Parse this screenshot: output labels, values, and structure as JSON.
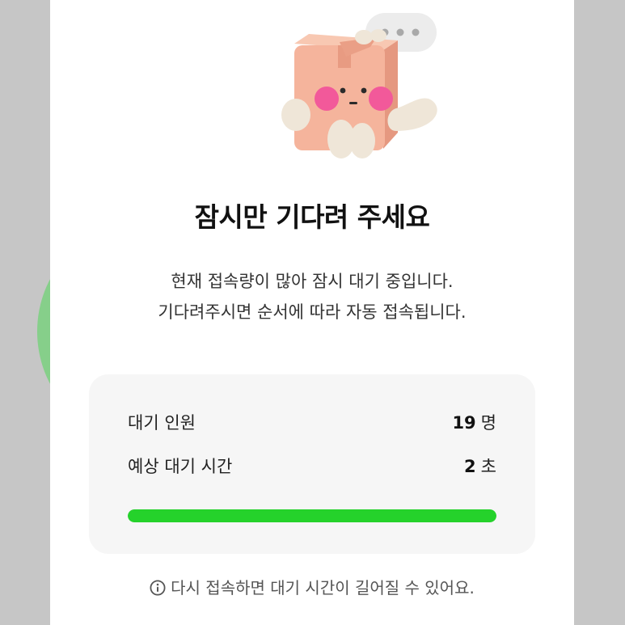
{
  "waiting": {
    "title": "잠시만 기다려 주세요",
    "message_line1": "현재 접속량이 많아 잠시 대기 중입니다.",
    "message_line2": "기다려주시면 순서에 따라 자동 접속됩니다.",
    "queue_label": "대기 인원",
    "queue_count": "19",
    "queue_unit": "명",
    "wait_label": "예상 대기 시간",
    "wait_time": "2",
    "wait_unit": "초",
    "progress": 1.0,
    "notice": "다시 접속하면 대기 시간이 길어질 수 있어요."
  },
  "icons": {
    "mascot": "box-character-icon",
    "speech_bubble": "speech-bubble-icon",
    "info": "info-icon"
  },
  "colors": {
    "progress": "#25d22b",
    "box": "#f5b49c",
    "cheeks": "#f2599a"
  }
}
